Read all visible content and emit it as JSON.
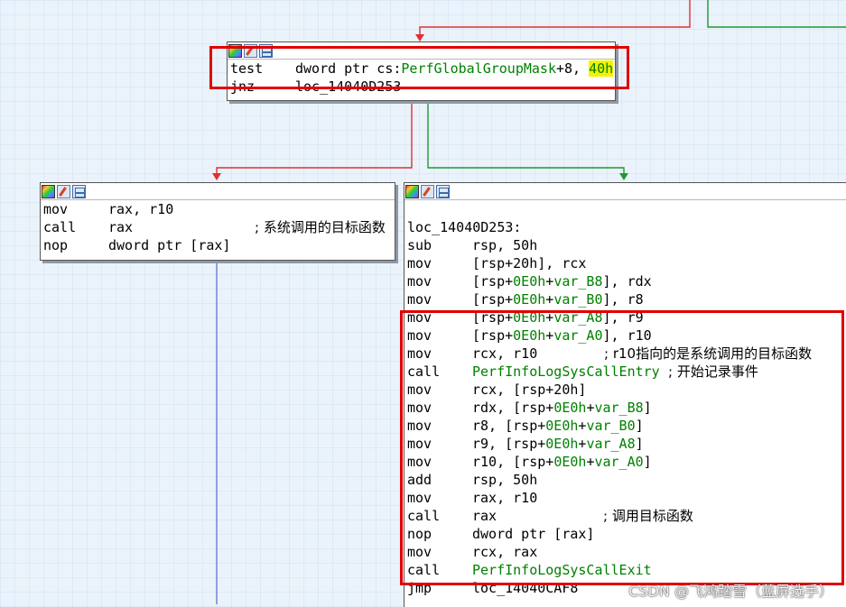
{
  "node_top": {
    "lines": [
      {
        "mnemonic": "test",
        "operand_plain": "dword ptr cs:",
        "operand_green": "PerfGlobalGroupMask",
        "operand_tail": "+8, ",
        "operand_hl": "40h"
      },
      {
        "mnemonic": "jnz",
        "operand": "loc_14040D253"
      }
    ]
  },
  "node_left": {
    "lines": [
      {
        "mnemonic": "mov",
        "operand": "rax, r10"
      },
      {
        "mnemonic": "call",
        "operand": "rax",
        "comment": "; 系统调用的目标函数"
      },
      {
        "mnemonic": "nop",
        "operand": "dword ptr [rax]"
      }
    ]
  },
  "node_right": {
    "label": "loc_14040D253:",
    "l1": {
      "mnemonic": "sub",
      "operand": "rsp, 50h"
    },
    "l2": {
      "mnemonic": "mov",
      "operand": "[rsp+20h], rcx"
    },
    "l3": {
      "mnemonic": "mov",
      "a": "[rsp+",
      "b": "0E0h",
      "c": "+",
      "d": "var_B8",
      "e": "], rdx"
    },
    "l4": {
      "mnemonic": "mov",
      "a": "[rsp+",
      "b": "0E0h",
      "c": "+",
      "d": "var_B0",
      "e": "], r8"
    },
    "l5": {
      "mnemonic": "mov",
      "a": "[rsp+",
      "b": "0E0h",
      "c": "+",
      "d": "var_A8",
      "e": "], r9"
    },
    "l6": {
      "mnemonic": "mov",
      "a": "[rsp+",
      "b": "0E0h",
      "c": "+",
      "d": "var_A0",
      "e": "], r10"
    },
    "l7": {
      "mnemonic": "mov",
      "operand": "rcx, r10",
      "comment": "; r10指向的是系统调用的目标函数"
    },
    "l8": {
      "mnemonic": "call",
      "operand": "PerfInfoLogSysCallEntry",
      "comment": "; 开始记录事件"
    },
    "l9": {
      "mnemonic": "mov",
      "operand": "rcx, [rsp+20h]"
    },
    "l10": {
      "mnemonic": "mov",
      "a": "rdx, [rsp+",
      "b": "0E0h",
      "c": "+",
      "d": "var_B8",
      "e": "]"
    },
    "l11": {
      "mnemonic": "mov",
      "a": "r8, [rsp+",
      "b": "0E0h",
      "c": "+",
      "d": "var_B0",
      "e": "]"
    },
    "l12": {
      "mnemonic": "mov",
      "a": "r9, [rsp+",
      "b": "0E0h",
      "c": "+",
      "d": "var_A8",
      "e": "]"
    },
    "l13": {
      "mnemonic": "mov",
      "a": "r10, [rsp+",
      "b": "0E0h",
      "c": "+",
      "d": "var_A0",
      "e": "]"
    },
    "l14": {
      "mnemonic": "add",
      "operand": "rsp, 50h"
    },
    "l15": {
      "mnemonic": "mov",
      "operand": "rax, r10"
    },
    "l16": {
      "mnemonic": "call",
      "operand": "rax",
      "comment": "; 调用目标函数"
    },
    "l17": {
      "mnemonic": "nop",
      "operand": "dword ptr [rax]"
    },
    "l18": {
      "mnemonic": "mov",
      "operand": "rcx, rax"
    },
    "l19": {
      "mnemonic": "call",
      "operand": "PerfInfoLogSysCallExit"
    },
    "l20": {
      "mnemonic": "jmp",
      "operand": "loc_14040CAF8"
    }
  },
  "icons": [
    "color-icon",
    "rename-icon",
    "graph-overview-icon"
  ],
  "colors": {
    "edge_false": "#e03030",
    "edge_true": "#1e9a2e",
    "edge_uncond": "#6b7fd8",
    "highlight_box": "#e00000"
  },
  "watermark": "CSDN @飞鸿踏雪（蓝屏选手）"
}
